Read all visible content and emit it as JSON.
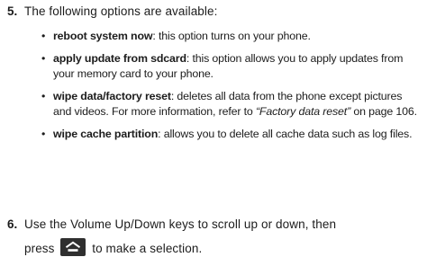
{
  "steps": [
    {
      "number": "5.",
      "text": "The following options are available:"
    },
    {
      "number": "6.",
      "text_line1": "Use the Volume Up/Down keys to scroll up or down, then",
      "text_before_icon": "press",
      "text_after_icon": "to make a selection.",
      "icon": "home-key-icon"
    }
  ],
  "options": [
    {
      "bullet": "•",
      "term": "reboot system now",
      "desc": ": this option turns on your phone."
    },
    {
      "bullet": "•",
      "term": "apply update from sdcard",
      "desc": ": this option allows you to apply updates from your memory card to your phone."
    },
    {
      "bullet": "•",
      "term": "wipe data/factory reset",
      "desc": ": deletes all data from the phone except pictures and videos. For more information, refer to ",
      "xref": "“Factory data reset”",
      "page_ref": " on page 106."
    },
    {
      "bullet": "•",
      "term": "wipe cache partition",
      "desc": ": allows you to delete all cache data such as log files."
    }
  ],
  "colors": {
    "text": "#1c1c1c",
    "icon_bg": "#2f2f2f",
    "icon_fg": "#ffffff"
  }
}
